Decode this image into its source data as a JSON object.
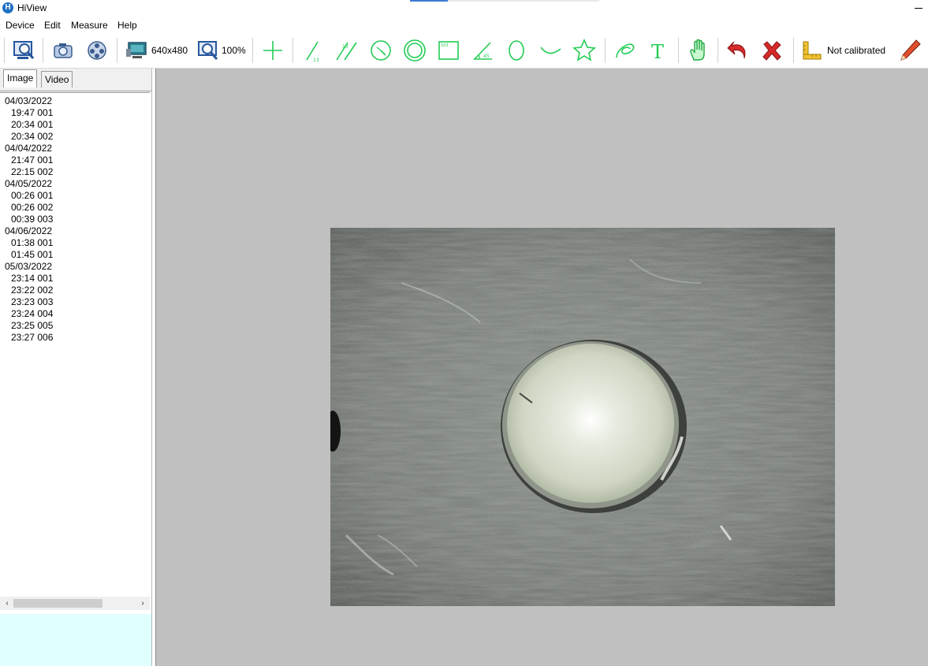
{
  "app": {
    "title": "HiView",
    "logo_letter": "H"
  },
  "menu": [
    "Device",
    "Edit",
    "Measure",
    "Help"
  ],
  "toolbar": {
    "resolution_label": "640x480",
    "zoom_label": "100%",
    "calibration_label": "Not calibrated",
    "icons": [
      "preview-icon",
      "capture-icon",
      "record-icon",
      "resolution-icon",
      "zoom-icon",
      "crosshair-icon",
      "line-measure-icon",
      "parallel-lines-icon",
      "circle-radius-icon",
      "concentric-circles-icon",
      "rectangle-icon",
      "angle-icon",
      "ellipse-icon",
      "arc-icon",
      "polygon-icon",
      "freehand-icon",
      "text-icon",
      "hand-pan-icon",
      "undo-icon",
      "delete-icon",
      "ruler-calibrate-icon",
      "pencil-icon"
    ],
    "accent_color": "#22cc55"
  },
  "tabs": {
    "image": "Image",
    "video": "Video",
    "active": "Image"
  },
  "file_tree": [
    {
      "date": "04/03/2022",
      "items": [
        "19:47 001",
        "20:34 001",
        "20:34 002"
      ]
    },
    {
      "date": "04/04/2022",
      "items": [
        "21:47 001",
        "22:15 002"
      ]
    },
    {
      "date": "04/05/2022",
      "items": [
        "00:26 001",
        "00:26 002",
        "00:39 003"
      ]
    },
    {
      "date": "04/06/2022",
      "items": [
        "01:38 001",
        "01:45 001"
      ]
    },
    {
      "date": "05/03/2022",
      "items": [
        "23:14 001",
        "23:22 002",
        "23:23 003",
        "23:24 004",
        "23:25 005",
        "23:27 006"
      ]
    }
  ],
  "colors": {
    "canvas_bg": "#c0c0c0",
    "info_box_bg": "#dfffff"
  }
}
